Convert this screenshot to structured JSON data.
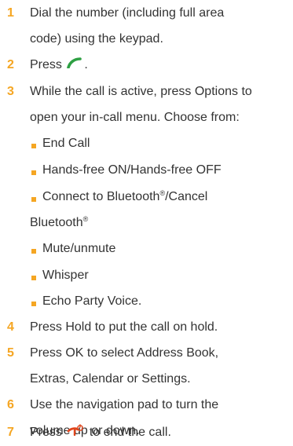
{
  "colors": {
    "number": "#f5a623",
    "bullet": "#f5a623",
    "text": "#333333",
    "send_icon": "#2ea043",
    "end_icon": "#e0441b"
  },
  "steps": [
    {
      "num": "1",
      "lines": [
        "Dial the number (including full area",
        "code) using the keypad."
      ]
    },
    {
      "num": "2",
      "before": "Press",
      "icon": "send-call-icon",
      "after": "."
    },
    {
      "num": "3",
      "lines": [
        "While the call is active, press Options to",
        "open your in-call menu. Choose from:"
      ]
    },
    {
      "num": "4",
      "lines": [
        "Press Hold to put the call on hold."
      ]
    },
    {
      "num": "5",
      "lines": [
        "Press OK to select Address Book,",
        "Extras, Calendar or Settings."
      ]
    },
    {
      "num": "6",
      "lines": [
        "Use the navigation pad to turn the",
        "volume up or down."
      ]
    },
    {
      "num": "7",
      "before": "Press",
      "icon": "end-call-icon",
      "after": "to end the call."
    }
  ],
  "menu_options": [
    {
      "text": "End Call"
    },
    {
      "text": "Hands-free ON/Hands-free OFF"
    },
    {
      "text": "Connect to Bluetooth",
      "reg1": "®",
      "mid": "/Cancel"
    },
    {
      "text": "Bluetooth",
      "reg2": "®"
    },
    {
      "text": "Mute/unmute"
    },
    {
      "text": "Whisper"
    },
    {
      "text": "Echo Party Voice."
    }
  ]
}
